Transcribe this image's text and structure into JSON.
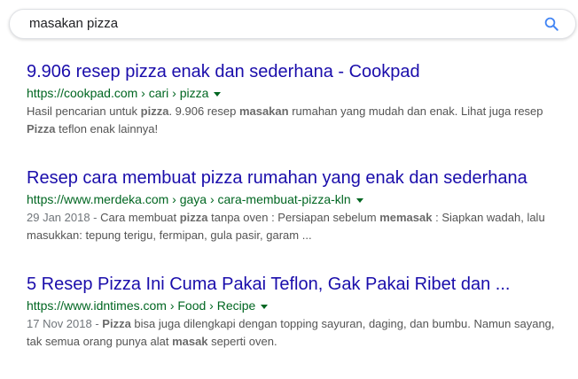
{
  "search": {
    "query": "masakan pizza",
    "icon": "search-icon"
  },
  "results": [
    {
      "title": "9.906 resep pizza enak dan sederhana - Cookpad",
      "url": "https://cookpad.com › cari › pizza",
      "date": "",
      "snippet_parts": [
        {
          "text": "Hasil pencarian untuk ",
          "bold": false
        },
        {
          "text": "pizza",
          "bold": true
        },
        {
          "text": ". 9.906 resep ",
          "bold": false
        },
        {
          "text": "masakan",
          "bold": true
        },
        {
          "text": " rumahan yang mudah dan enak. Lihat juga resep ",
          "bold": false
        },
        {
          "text": "Pizza",
          "bold": true
        },
        {
          "text": " teflon enak lainnya!",
          "bold": false
        }
      ]
    },
    {
      "title": "Resep cara membuat pizza rumahan yang enak dan sederhana",
      "url": "https://www.merdeka.com › gaya › cara-membuat-pizza-kln",
      "date": "29 Jan 2018 - ",
      "snippet_parts": [
        {
          "text": "Cara membuat ",
          "bold": false
        },
        {
          "text": "pizza",
          "bold": true
        },
        {
          "text": " tanpa oven : Persiapan sebelum ",
          "bold": false
        },
        {
          "text": "memasak",
          "bold": true
        },
        {
          "text": " : Siapkan wadah, lalu masukkan: tepung terigu, fermipan, gula pasir, garam ...",
          "bold": false
        }
      ]
    },
    {
      "title": "5 Resep Pizza Ini Cuma Pakai Teflon, Gak Pakai Ribet dan ...",
      "url": "https://www.idntimes.com › Food › Recipe",
      "date": "17 Nov 2018 - ",
      "snippet_parts": [
        {
          "text": "Pizza",
          "bold": true
        },
        {
          "text": " bisa juga dilengkapi dengan topping sayuran, daging, dan bumbu. Namun sayang, tak semua orang punya alat ",
          "bold": false
        },
        {
          "text": "masak",
          "bold": true
        },
        {
          "text": " seperti oven.",
          "bold": false
        }
      ]
    }
  ],
  "colors": {
    "title_link": "#1a0dab",
    "url_green": "#006621",
    "snippet_gray": "#545454",
    "search_icon_blue": "#4285f4"
  }
}
